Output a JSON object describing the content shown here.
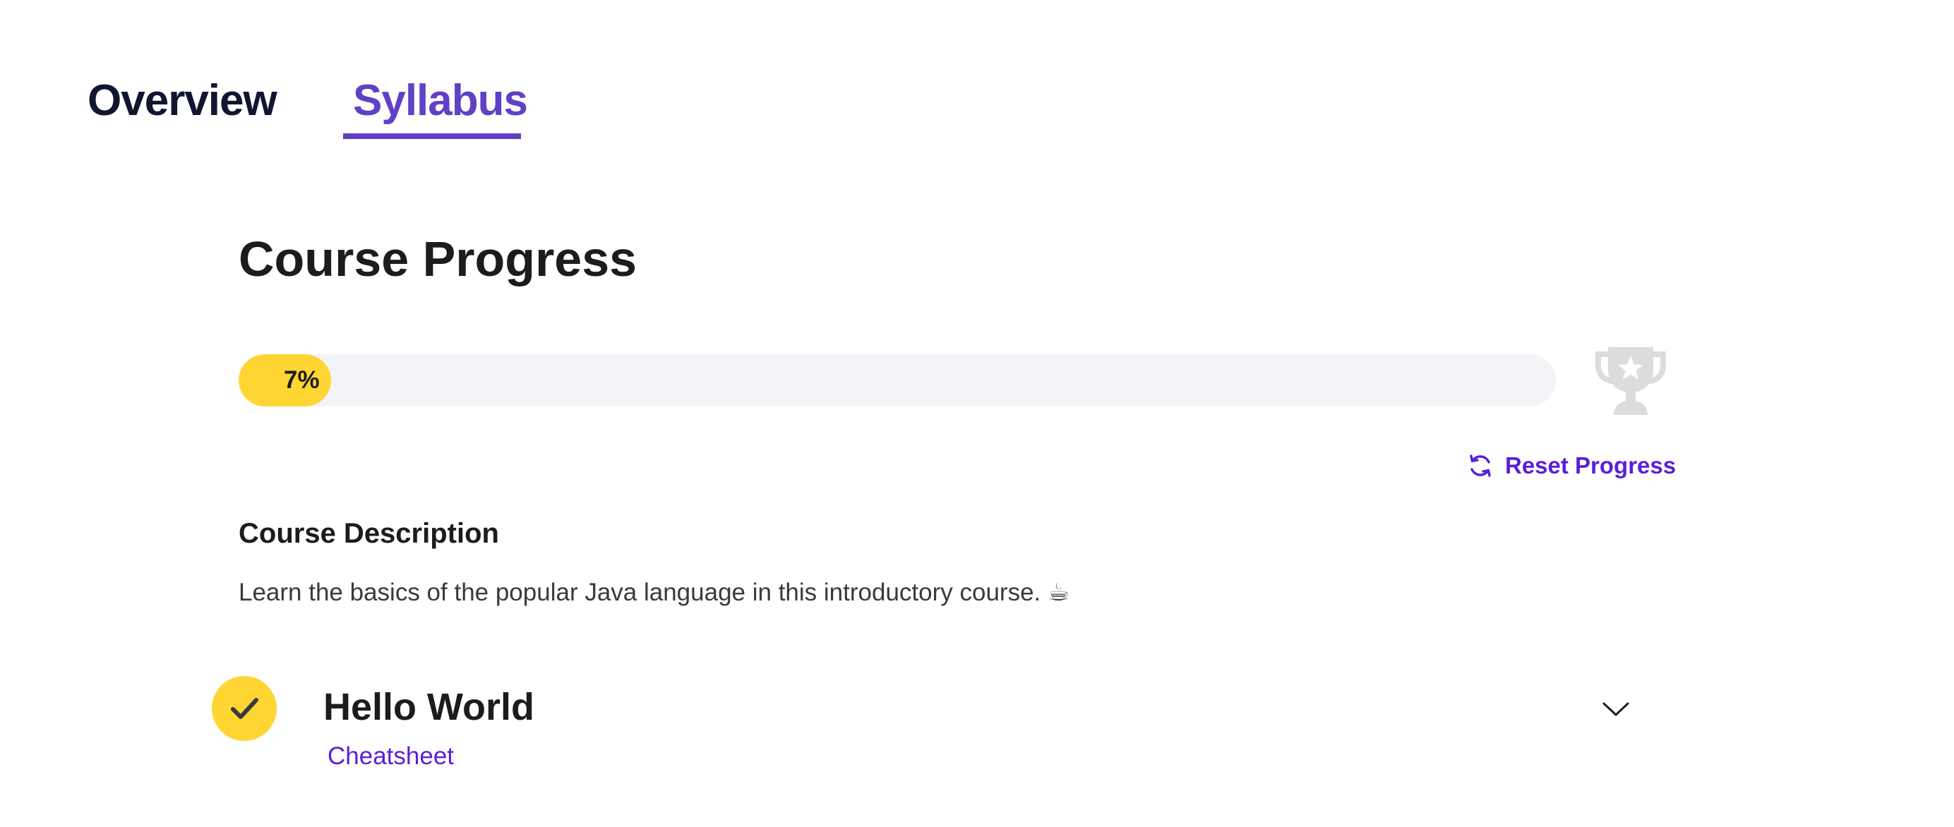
{
  "tabs": {
    "overview_label": "Overview",
    "syllabus_label": "Syllabus",
    "active": "Syllabus"
  },
  "progress": {
    "heading": "Course Progress",
    "percent_label": "7%",
    "percent_value": 7,
    "reset_label": "Reset Progress"
  },
  "description": {
    "heading": "Course Description",
    "text": "Learn the basics of the popular Java language in this introductory course. ☕"
  },
  "modules": [
    {
      "title": "Hello World",
      "link_label": "Cheatsheet",
      "completed": true
    }
  ],
  "icons": {
    "trophy": "trophy-icon",
    "reset": "refresh-icon",
    "check": "checkmark-icon",
    "chevron": "chevron-down-icon"
  },
  "colors": {
    "accent_purple": "#6140c6",
    "link_purple": "#5a1fd8",
    "progress_yellow": "#ffd534",
    "track_gray": "#f4f4f8",
    "trophy_gray": "#dcdcdf"
  }
}
